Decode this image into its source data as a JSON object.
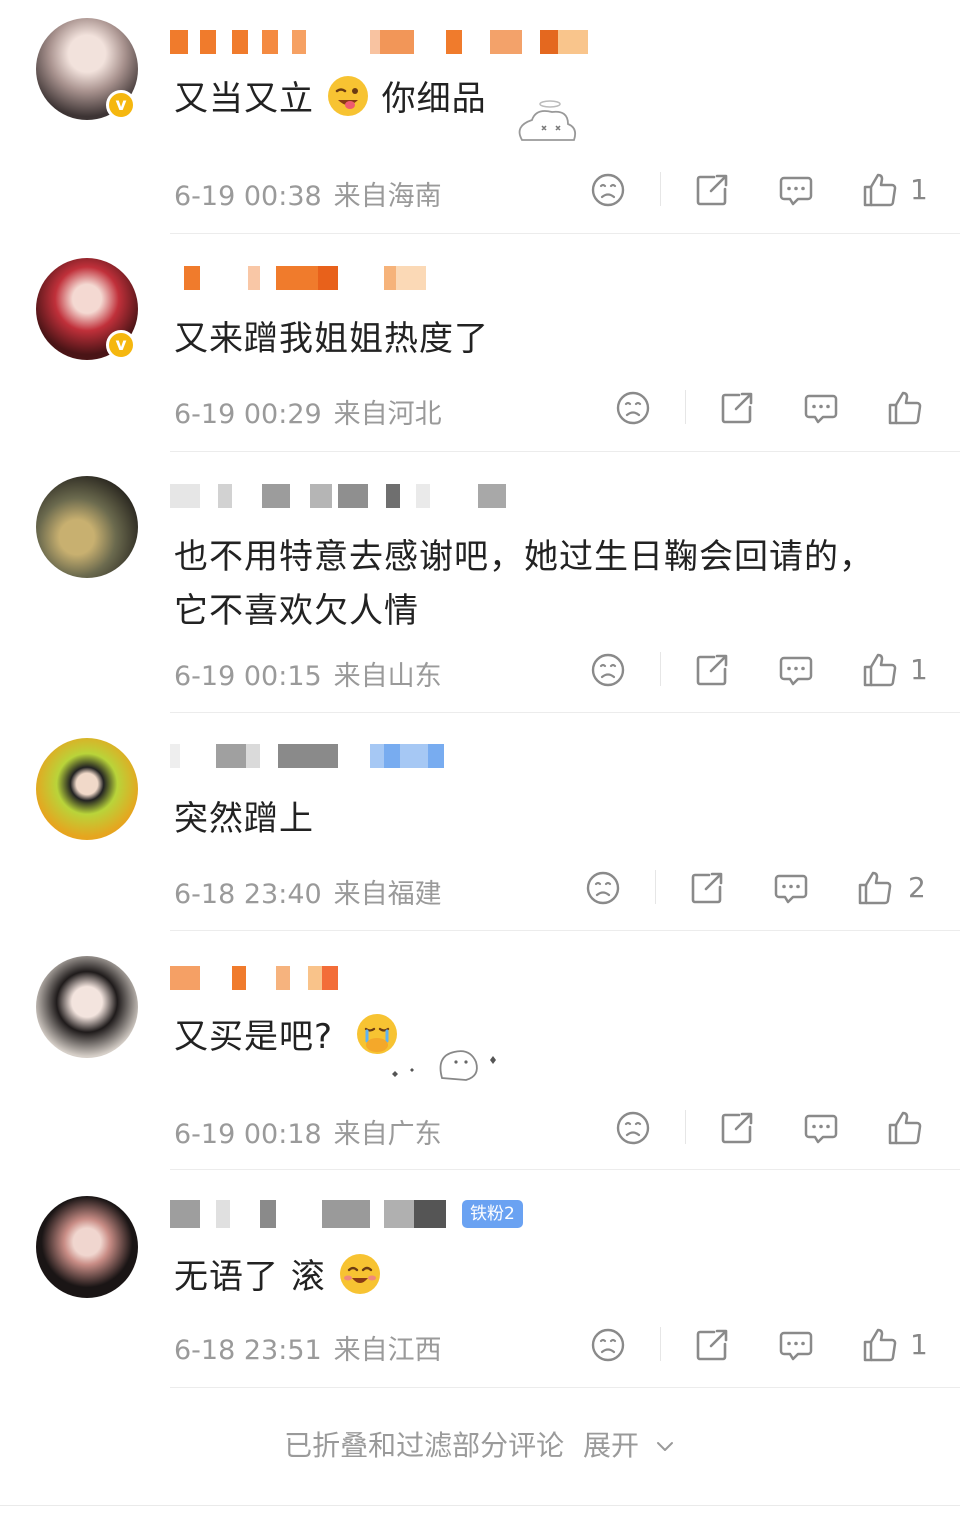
{
  "comments": [
    {
      "text": "又当又立",
      "text_after": "你细品",
      "emoji": "wink-tongue-emoji",
      "time": "6-19 00:38",
      "location": "来自海南",
      "likes": "1",
      "verified": true
    },
    {
      "text": "又来蹭我姐姐热度了",
      "text_after": "",
      "time": "6-19 00:29",
      "location": "来自河北",
      "likes": "",
      "verified": true
    },
    {
      "text": "也不用特意去感谢吧，她过生日鞠会回请的，",
      "text_line2": "它不喜欢欠人情",
      "time": "6-19 00:15",
      "location": "来自山东",
      "likes": "1",
      "verified": false
    },
    {
      "text": "突然蹭上",
      "time": "6-18 23:40",
      "location": "来自福建",
      "likes": "2",
      "verified": false
    },
    {
      "text": "又买是吧?",
      "emoji": "crying-hand-over-mouth-emoji",
      "time": "6-19 00:18",
      "location": "来自广东",
      "likes": "",
      "verified": false
    },
    {
      "text": "无语了 滚",
      "emoji": "smile-emoji",
      "fan_badge": "铁粉2",
      "time": "6-18 23:51",
      "location": "来自江西",
      "likes": "1",
      "verified": false
    }
  ],
  "footer": {
    "collapse_text": "已折叠和过滤部分评论",
    "expand_label": "展开"
  },
  "colors": {
    "verified": "#f5b70f",
    "fan_badge": "#6aa2f2",
    "meta": "#9a9a9a"
  }
}
